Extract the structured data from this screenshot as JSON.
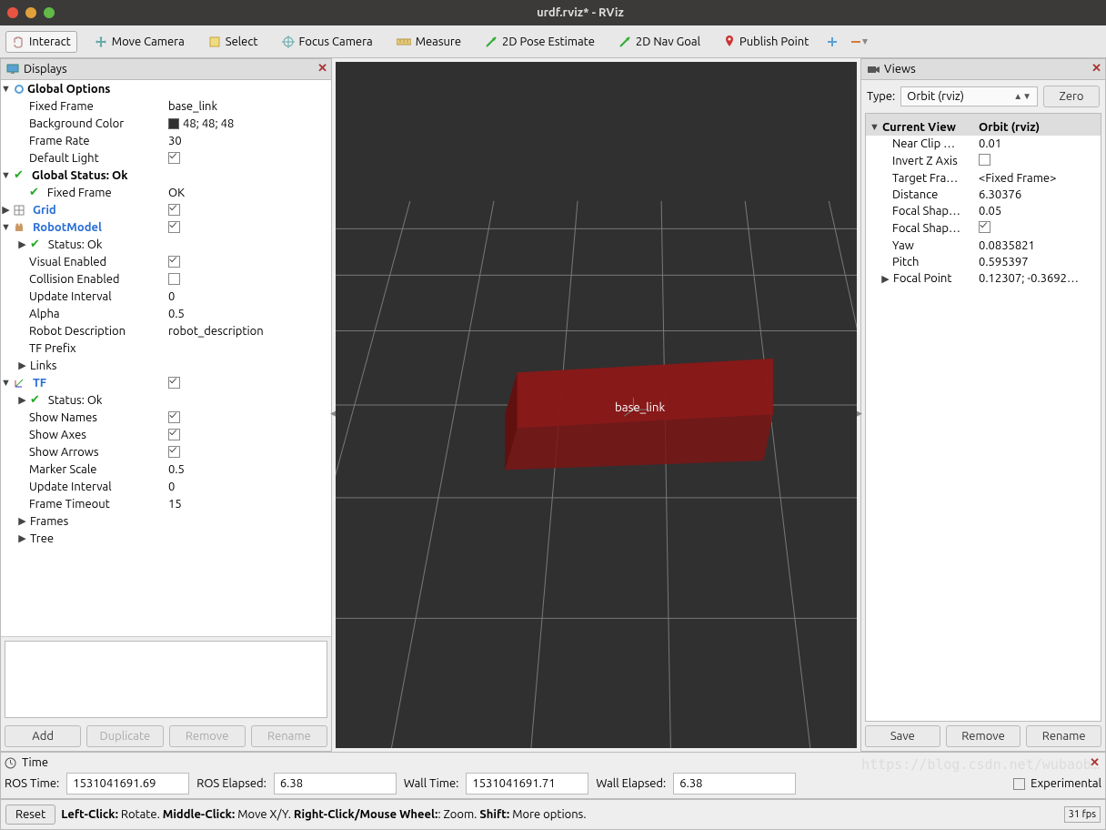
{
  "window": {
    "title": "urdf.rviz* - RViz"
  },
  "toolbar": {
    "interact": "Interact",
    "move_camera": "Move Camera",
    "select": "Select",
    "focus_camera": "Focus Camera",
    "measure": "Measure",
    "pose_estimate": "2D Pose Estimate",
    "nav_goal": "2D Nav Goal",
    "publish_point": "Publish Point"
  },
  "displays": {
    "title": "Displays",
    "global_options": "Global Options",
    "fixed_frame": {
      "k": "Fixed Frame",
      "v": "base_link"
    },
    "bg": {
      "k": "Background Color",
      "v": "48; 48; 48"
    },
    "frame_rate": {
      "k": "Frame Rate",
      "v": "30"
    },
    "default_light": {
      "k": "Default Light",
      "checked": true
    },
    "global_status": "Global Status: Ok",
    "global_status_frame": {
      "k": "Fixed Frame",
      "v": "OK"
    },
    "grid": "Grid",
    "robot_model": "RobotModel",
    "rm_status": "Status: Ok",
    "rm_visual": {
      "k": "Visual Enabled",
      "checked": true
    },
    "rm_collision": {
      "k": "Collision Enabled",
      "checked": false
    },
    "rm_update": {
      "k": "Update Interval",
      "v": "0"
    },
    "rm_alpha": {
      "k": "Alpha",
      "v": "0.5"
    },
    "rm_desc": {
      "k": "Robot Description",
      "v": "robot_description"
    },
    "rm_tfprefix": {
      "k": "TF Prefix",
      "v": ""
    },
    "rm_links": "Links",
    "tf": "TF",
    "tf_status": "Status: Ok",
    "tf_names": {
      "k": "Show Names",
      "checked": true
    },
    "tf_axes": {
      "k": "Show Axes",
      "checked": true
    },
    "tf_arrows": {
      "k": "Show Arrows",
      "checked": true
    },
    "tf_marker": {
      "k": "Marker Scale",
      "v": "0.5"
    },
    "tf_update": {
      "k": "Update Interval",
      "v": "0"
    },
    "tf_timeout": {
      "k": "Frame Timeout",
      "v": "15"
    },
    "tf_frames": "Frames",
    "tf_tree": "Tree",
    "btn_add": "Add",
    "btn_dup": "Duplicate",
    "btn_rem": "Remove",
    "btn_ren": "Rename"
  },
  "views": {
    "title": "Views",
    "type_label": "Type:",
    "type": "Orbit (rviz)",
    "zero": "Zero",
    "current_view": "Current View",
    "current_view_v": "Orbit (rviz)",
    "near_clip": {
      "k": "Near Clip …",
      "v": "0.01"
    },
    "invert_z": {
      "k": "Invert Z Axis",
      "checked": false
    },
    "target": {
      "k": "Target Fra…",
      "v": "<Fixed Frame>"
    },
    "distance": {
      "k": "Distance",
      "v": "6.30376"
    },
    "fshapes": {
      "k": "Focal Shap…",
      "v": "0.05"
    },
    "fshapef": {
      "k": "Focal Shap…",
      "checked": true
    },
    "yaw": {
      "k": "Yaw",
      "v": "0.0835821"
    },
    "pitch": {
      "k": "Pitch",
      "v": "0.595397"
    },
    "focal": {
      "k": "Focal Point",
      "v": "0.12307; -0.3692…"
    },
    "btn_save": "Save",
    "btn_rem": "Remove",
    "btn_ren": "Rename"
  },
  "time": {
    "title": "Time",
    "ros_time_l": "ROS Time:",
    "ros_time": "1531041691.69",
    "ros_elapsed_l": "ROS Elapsed:",
    "ros_elapsed": "6.38",
    "wall_time_l": "Wall Time:",
    "wall_time": "1531041691.71",
    "wall_elapsed_l": "Wall Elapsed:",
    "wall_elapsed": "6.38",
    "experimental": "Experimental"
  },
  "status": {
    "reset": "Reset",
    "help": {
      "a": "Left-Click:",
      "at": " Rotate. ",
      "b": "Middle-Click:",
      "bt": " Move X/Y. ",
      "c": "Right-Click/Mouse Wheel:",
      "ct": ": Zoom. ",
      "d": "Shift:",
      "dt": " More options."
    },
    "fps": "31 fps"
  },
  "watermark": "https://blog.csdn.net/wubaob…"
}
